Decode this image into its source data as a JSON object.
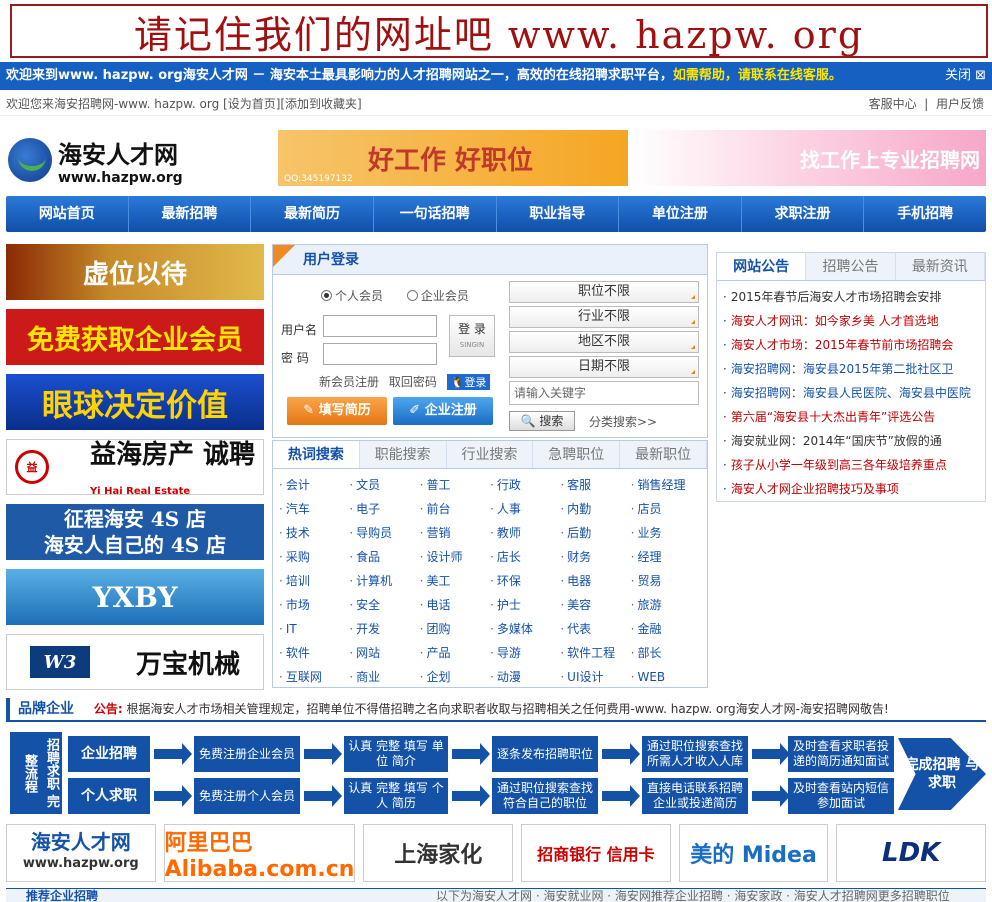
{
  "banner": {
    "text": "请记住我们的网址吧  www. hazpw. org"
  },
  "welcome": {
    "text": "欢迎来到www. hazpw. org海安人才网 － 海安本土最具影响力的人才招聘网站之一，高效的在线招聘求职平台，",
    "help": "如需帮助，请联系在线客服。",
    "close": "关闭"
  },
  "subbar": {
    "left": "欢迎您来海安招聘网-www. hazpw. org [设为首页][添加到收藏夹]",
    "service": "客服中心",
    "feedback": "用户反馈"
  },
  "logo": {
    "cn": "海安人才网",
    "en": "www.hazpw.org"
  },
  "topads": {
    "ad1": "好工作 好职位",
    "ad1_qq": "QQ:345197132",
    "ad2": "找工作上专业招聘网"
  },
  "nav": [
    "网站首页",
    "最新招聘",
    "最新简历",
    "一句话招聘",
    "职业指导",
    "单位注册",
    "求职注册",
    "手机招聘"
  ],
  "leftads": {
    "a1": "虚位以待",
    "a2": "免费获取企业会员",
    "a3": "眼球决定价值",
    "a4": "益海房产 诚聘",
    "a4_sub": "Yi Hai Real Estate",
    "a5_l1": "征程海安 4S 店",
    "a5_l2": "海安人自己的 4S 店",
    "a6": "YXBY",
    "a7": "万宝机械"
  },
  "login": {
    "title": "用户登录",
    "radio_person": "个人会员",
    "radio_company": "企业会员",
    "username_label": "用户名",
    "password_label": "密  码",
    "login_btn": "登 录",
    "login_btn_sub": "SINGIN",
    "register": "新会员注册",
    "forgot": "取回密码",
    "qq_login": "登录",
    "fill_resume": "填写简历",
    "company_reg": "企业注册",
    "sel_position": "职位不限",
    "sel_industry": "行业不限",
    "sel_area": "地区不限",
    "sel_date": "日期不限",
    "keyword_placeholder": "请输入关键字",
    "search": "搜索",
    "cat_search": "分类搜索>>"
  },
  "hotwords": {
    "tabs": [
      "热词搜索",
      "职能搜索",
      "行业搜索",
      "急聘职位",
      "最新职位"
    ],
    "items": [
      "会计",
      "文员",
      "普工",
      "行政",
      "客服",
      "销售经理",
      "汽车",
      "电子",
      "前台",
      "人事",
      "内勤",
      "店员",
      "技术",
      "导购员",
      "营销",
      "教师",
      "后勤",
      "业务",
      "采购",
      "食品",
      "设计师",
      "店长",
      "财务",
      "经理",
      "培训",
      "计算机",
      "美工",
      "环保",
      "电器",
      "贸易",
      "市场",
      "安全",
      "电话",
      "护士",
      "美容",
      "旅游",
      "IT",
      "开发",
      "团购",
      "多媒体",
      "代表",
      "金融",
      "软件",
      "网站",
      "产品",
      "导游",
      "软件工程",
      "部长",
      "互联网",
      "商业",
      "企划",
      "动漫",
      "UI设计",
      "WEB"
    ]
  },
  "notice": {
    "tabs": [
      "网站公告",
      "招聘公告",
      "最新资讯"
    ],
    "items": [
      {
        "text": "2015年春节后海安人才市场招聘会安排",
        "color": "#333333"
      },
      {
        "text": "海安人才网讯：如今家乡美 人才首选地",
        "color": "#c00000"
      },
      {
        "text": "海安人才市场：2015年春节前市场招聘会",
        "color": "#c00000"
      },
      {
        "text": "海安招聘网：海安县2015年第二批社区卫",
        "color": "#1452a8"
      },
      {
        "text": "海安招聘网：海安县人民医院、海安县中医院",
        "color": "#1452a8"
      },
      {
        "text": "第六届“海安县十大杰出青年”评选公告",
        "color": "#c00000"
      },
      {
        "text": "海安就业网：2014年“国庆节”放假的通",
        "color": "#333333"
      },
      {
        "text": "孩子从小学一年级到高三各年级培养重点",
        "color": "#c00000"
      },
      {
        "text": "海安人才网企业招聘技巧及事项",
        "color": "#c00000"
      }
    ]
  },
  "brand": {
    "title": "品牌企业",
    "notice_label": "公告:",
    "notice_text": "根据海安人才市场相关管理规定，招聘单位不得借招聘之名向求职者收取与招聘相关之任何费用-www. hazpw. org海安人才网-海安招聘网敬告!"
  },
  "flow": {
    "tag": "招聘求职 完整流程",
    "row1": [
      "企业招聘",
      "免费注册企业会员",
      "认真 完整 填写 单位 简介",
      "逐条发布招聘职位",
      "通过职位搜索查找 所需人才收入人库",
      "及时查看求职者投 递的简历通知面试"
    ],
    "row2": [
      "个人求职",
      "免费注册个人会员",
      "认真 完整 填写 个人 简历",
      "通过职位搜索查找 符合自己的职位",
      "直接电话联系招聘 企业或投递简历",
      "及时查看站内短信 参加面试"
    ],
    "final": "完成招聘 与求职"
  },
  "logos": {
    "l1": "海安人才网",
    "l1_sub": "www.hazpw.org",
    "l2": "阿里巴巴 Alibaba.com.cn",
    "l3": "上海家化",
    "l4": "招商银行 信用卡",
    "l5": "美的 Midea",
    "l6": "LDK"
  },
  "bottom": {
    "title": "推荐企业招聘",
    "right": "以下为海安人才网 · 海安就业网 · 海安网推荐企业招聘 · 海安家政 · 海安人才招聘网更多招聘职位"
  }
}
